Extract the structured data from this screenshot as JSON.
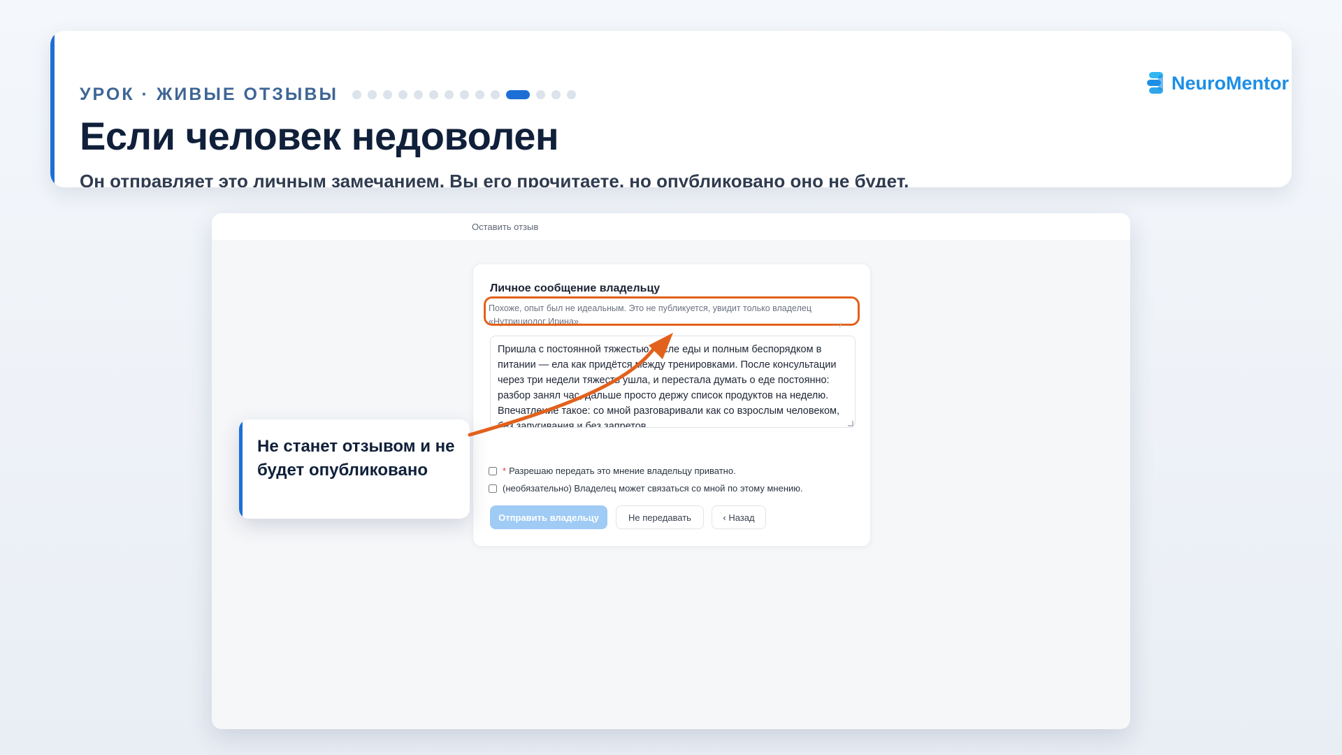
{
  "header": {
    "eyebrow": "УРОК · ЖИВЫЕ ОТЗЫВЫ",
    "progress": {
      "total": 14,
      "current": 11
    },
    "title": "Если человек недоволен",
    "subtitle": "Он отправляет это личным замечанием. Вы его прочитаете, но опубликовано оно не будет."
  },
  "logo": {
    "text": "NeuroMentor",
    "icon": "neuromentor-logo-icon",
    "color": "#1d8ee6"
  },
  "screenshot": {
    "breadcrumb": "Оставить отзыв",
    "form": {
      "title": "Личное сообщение владельцу",
      "hint": "Похоже, опыт был не идеальным. Это не публикуется, увидит только владелец «Нутрициолог Ирина».",
      "message": "Пришла с постоянной тяжестью после еды и полным беспорядком в питании — ела как придётся между тренировками. После консультации через три недели тяжесть ушла, и перестала думать о еде постоянно: разбор занял час, дальше просто держу список продуктов на неделю. Впечатление такое: со мной разговаривали как со взрослым человеком, без запугивания и без запретов.",
      "consent_required_marker": "*",
      "consent_label": "Разрешаю передать это мнение владельцу приватно.",
      "contact_label": "(необязательно) Владелец может связаться со мной по этому мнению.",
      "submit_label": "Отправить владельцу",
      "decline_label": "Не передавать",
      "back_label": "‹ Назад"
    }
  },
  "callout": {
    "text": "Не станет отзывом и не будет опубликовано"
  },
  "colors": {
    "accent": "#1d6fd6",
    "highlight": "#e2611c",
    "primary_button": "#9fcbf5"
  }
}
